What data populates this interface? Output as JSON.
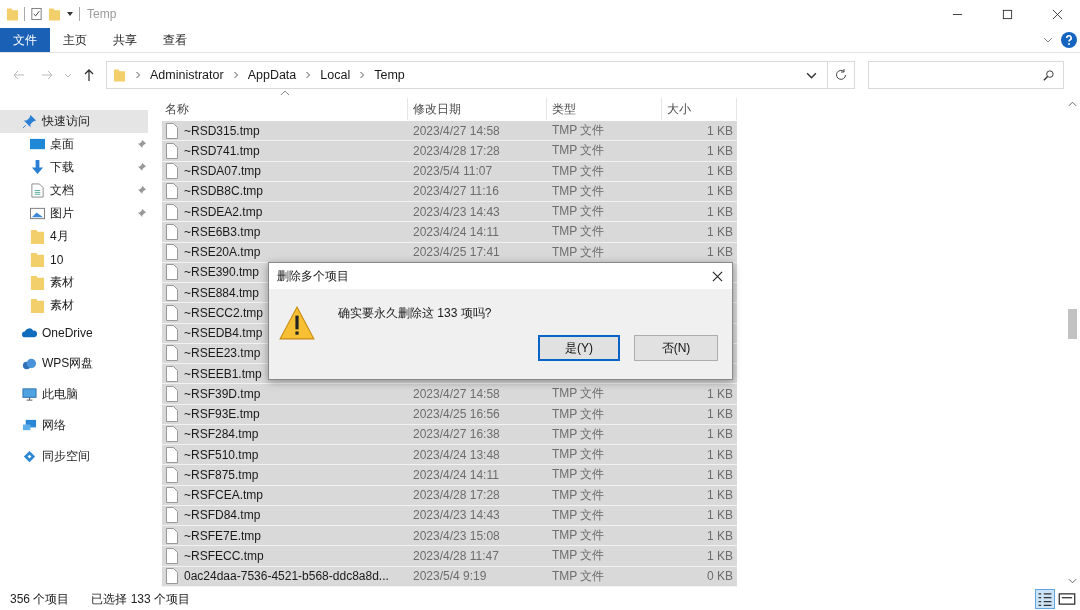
{
  "window": {
    "title": "Temp"
  },
  "ribbon": {
    "tabs": [
      {
        "label": "文件",
        "selected": true
      },
      {
        "label": "主页",
        "selected": false
      },
      {
        "label": "共享",
        "selected": false
      },
      {
        "label": "查看",
        "selected": false
      }
    ]
  },
  "address": {
    "crumbs": [
      "Administrator",
      "AppData",
      "Local",
      "Temp"
    ]
  },
  "sidebar": {
    "items": [
      {
        "label": "快速访问",
        "kind": "star",
        "pinned": false,
        "selected": true,
        "group": true
      },
      {
        "label": "桌面",
        "kind": "desktop",
        "pinned": true,
        "selected": false,
        "group": false
      },
      {
        "label": "下载",
        "kind": "download",
        "pinned": true,
        "selected": false,
        "group": false
      },
      {
        "label": "文档",
        "kind": "document",
        "pinned": true,
        "selected": false,
        "group": false
      },
      {
        "label": "图片",
        "kind": "picture",
        "pinned": true,
        "selected": false,
        "group": false
      },
      {
        "label": "4月",
        "kind": "folder",
        "pinned": false,
        "selected": false,
        "group": false
      },
      {
        "label": "10",
        "kind": "folder",
        "pinned": false,
        "selected": false,
        "group": false
      },
      {
        "label": "素材",
        "kind": "folder",
        "pinned": false,
        "selected": false,
        "group": false
      },
      {
        "label": "素材",
        "kind": "folder",
        "pinned": false,
        "selected": false,
        "group": false
      },
      {
        "label": "OneDrive",
        "kind": "cloud",
        "pinned": false,
        "selected": false,
        "group": true
      },
      {
        "label": "WPS网盘",
        "kind": "cloud2",
        "pinned": false,
        "selected": false,
        "group": true
      },
      {
        "label": "此电脑",
        "kind": "pc",
        "pinned": false,
        "selected": false,
        "group": true
      },
      {
        "label": "网络",
        "kind": "network",
        "pinned": false,
        "selected": false,
        "group": true
      },
      {
        "label": "同步空间",
        "kind": "sync",
        "pinned": false,
        "selected": false,
        "group": true
      }
    ]
  },
  "table": {
    "columns": [
      "名称",
      "修改日期",
      "类型",
      "大小"
    ],
    "rows": [
      {
        "name": "~RSD315.tmp",
        "date": "2023/4/27 14:58",
        "type": "TMP 文件",
        "size": "1 KB",
        "selected": true
      },
      {
        "name": "~RSD741.tmp",
        "date": "2023/4/28 17:28",
        "type": "TMP 文件",
        "size": "1 KB",
        "selected": true
      },
      {
        "name": "~RSDA07.tmp",
        "date": "2023/5/4 11:07",
        "type": "TMP 文件",
        "size": "1 KB",
        "selected": true
      },
      {
        "name": "~RSDB8C.tmp",
        "date": "2023/4/27 11:16",
        "type": "TMP 文件",
        "size": "1 KB",
        "selected": true
      },
      {
        "name": "~RSDEA2.tmp",
        "date": "2023/4/23 14:43",
        "type": "TMP 文件",
        "size": "1 KB",
        "selected": true
      },
      {
        "name": "~RSE6B3.tmp",
        "date": "2023/4/24 14:11",
        "type": "TMP 文件",
        "size": "1 KB",
        "selected": true
      },
      {
        "name": "~RSE20A.tmp",
        "date": "2023/4/25 17:41",
        "type": "TMP 文件",
        "size": "1 KB",
        "selected": true
      },
      {
        "name": "~RSE390.tmp",
        "selected": true
      },
      {
        "name": "~RSE884.tmp",
        "selected": true
      },
      {
        "name": "~RSECC2.tmp",
        "selected": true
      },
      {
        "name": "~RSEDB4.tmp",
        "selected": true
      },
      {
        "name": "~RSEE23.tmp",
        "selected": true
      },
      {
        "name": "~RSEEB1.tmp",
        "selected": true
      },
      {
        "name": "~RSF39D.tmp",
        "date": "2023/4/27 14:58",
        "type": "TMP 文件",
        "size": "1 KB",
        "selected": true
      },
      {
        "name": "~RSF93E.tmp",
        "date": "2023/4/25 16:56",
        "type": "TMP 文件",
        "size": "1 KB",
        "selected": true
      },
      {
        "name": "~RSF284.tmp",
        "date": "2023/4/27 16:38",
        "type": "TMP 文件",
        "size": "1 KB",
        "selected": true
      },
      {
        "name": "~RSF510.tmp",
        "date": "2023/4/24 13:48",
        "type": "TMP 文件",
        "size": "1 KB",
        "selected": true
      },
      {
        "name": "~RSF875.tmp",
        "date": "2023/4/24 14:11",
        "type": "TMP 文件",
        "size": "1 KB",
        "selected": true
      },
      {
        "name": "~RSFCEA.tmp",
        "date": "2023/4/28 17:28",
        "type": "TMP 文件",
        "size": "1 KB",
        "selected": true
      },
      {
        "name": "~RSFD84.tmp",
        "date": "2023/4/23 14:43",
        "type": "TMP 文件",
        "size": "1 KB",
        "selected": true
      },
      {
        "name": "~RSFE7E.tmp",
        "date": "2023/4/23 15:08",
        "type": "TMP 文件",
        "size": "1 KB",
        "selected": true
      },
      {
        "name": "~RSFECC.tmp",
        "date": "2023/4/28 11:47",
        "type": "TMP 文件",
        "size": "1 KB",
        "selected": true
      },
      {
        "name": "0ac24daa-7536-4521-b568-ddc8a8d...",
        "date": "2023/5/4 9:19",
        "type": "TMP 文件",
        "size": "0 KB",
        "selected": true
      }
    ]
  },
  "dialog": {
    "title": "删除多个项目",
    "message": "确实要永久删除这 133 项吗?",
    "buttons": [
      {
        "label": "是(Y)",
        "selected": true
      },
      {
        "label": "否(N)",
        "selected": false
      }
    ]
  },
  "status_bar": {
    "count": "356 个项目",
    "selection": "已选择 133 个项目"
  }
}
